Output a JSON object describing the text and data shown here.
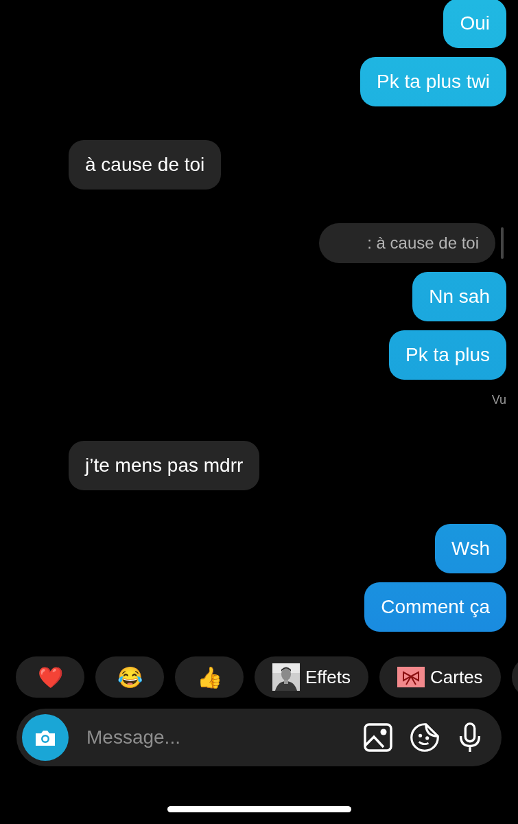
{
  "messages": [
    {
      "kind": "sent",
      "text": "Oui"
    },
    {
      "kind": "sent",
      "text": "Pk ta plus twi"
    },
    {
      "kind": "received",
      "text": "à cause de toi"
    },
    {
      "kind": "quote",
      "text": ": à cause de toi"
    },
    {
      "kind": "sent",
      "text": "Nn sah"
    },
    {
      "kind": "sent",
      "text": "Pk ta plus"
    },
    {
      "kind": "seen",
      "text": "Vu"
    },
    {
      "kind": "received",
      "text": "j’te mens pas mdrr"
    },
    {
      "kind": "sent",
      "text": "Wsh"
    },
    {
      "kind": "sent",
      "text": "Comment ça"
    }
  ],
  "quick_replies": [
    {
      "kind": "emoji",
      "text": "❤️"
    },
    {
      "kind": "emoji",
      "text": "😂"
    },
    {
      "kind": "emoji",
      "text": "👍"
    },
    {
      "kind": "effects",
      "text": "Effets"
    },
    {
      "kind": "cards",
      "text": "Cartes"
    },
    {
      "kind": "more"
    }
  ],
  "composer": {
    "placeholder": "Message..."
  }
}
